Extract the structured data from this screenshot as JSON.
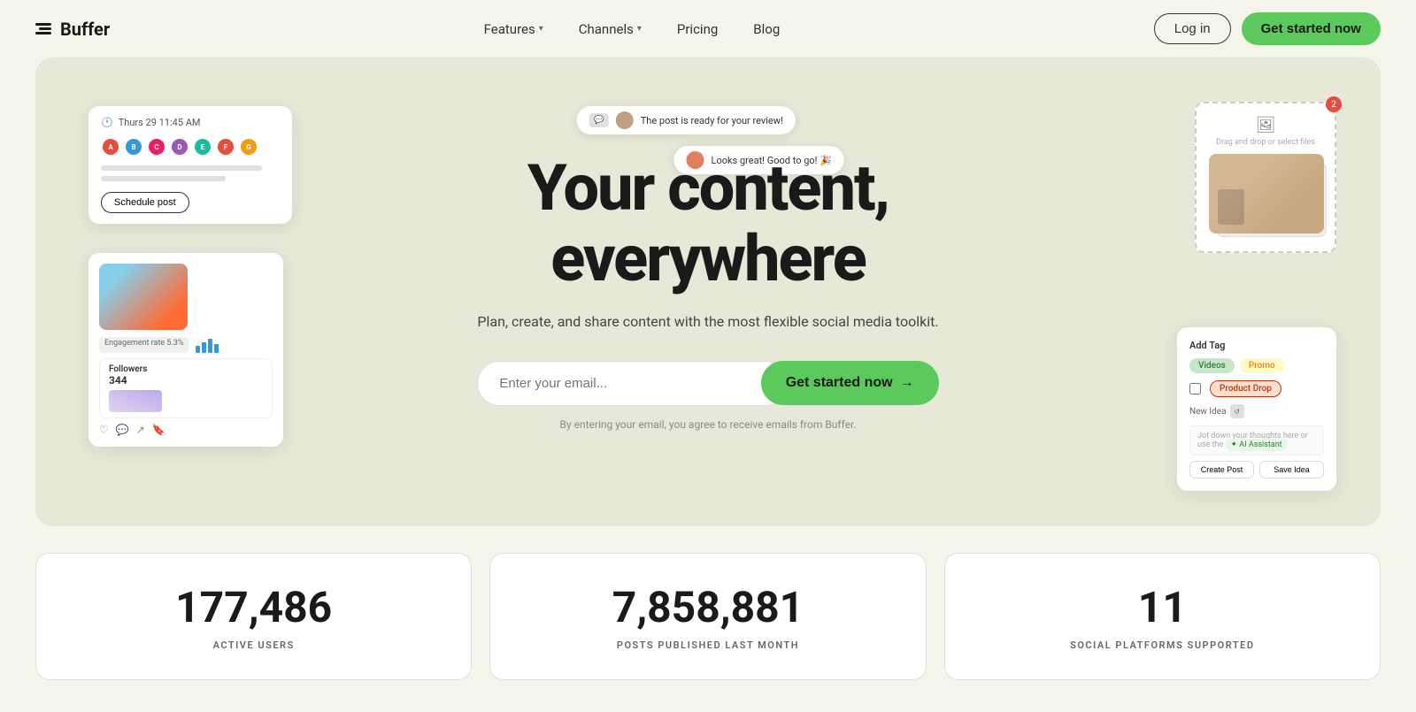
{
  "navbar": {
    "logo_text": "Buffer",
    "nav_items": [
      {
        "label": "Features",
        "has_dropdown": true
      },
      {
        "label": "Channels",
        "has_dropdown": true
      },
      {
        "label": "Pricing",
        "has_dropdown": false
      },
      {
        "label": "Blog",
        "has_dropdown": false
      }
    ],
    "login_label": "Log in",
    "get_started_label": "Get started now"
  },
  "hero": {
    "title_line1": "Your content,",
    "title_line2": "everywhere",
    "subtitle": "Plan, create, and share content with the most flexible social media toolkit.",
    "email_placeholder": "Enter your email...",
    "cta_label": "Get started now",
    "disclaimer": "By entering your email, you agree to receive emails from Buffer.",
    "review1": "The post is ready for your review!",
    "review2": "Looks great! Good to go! 🎉",
    "schedule_time": "Thurs 29  11:45 AM",
    "schedule_btn": "Schedule post",
    "drag_text": "Drag and drop or select files",
    "drag_badge": "2"
  },
  "floating": {
    "add_tag_title": "Add Tag",
    "tag1": "Videos",
    "tag2": "Promo",
    "tag3": "Product Drop",
    "new_idea_label": "New Idea",
    "jot_placeholder": "Jot down your thoughts here or use the",
    "ai_label": "✦ AI Assistant",
    "create_post_btn": "Create Post",
    "save_idea_btn": "Save Idea"
  },
  "stats": [
    {
      "number": "177,486",
      "label": "ACTIVE USERS"
    },
    {
      "number": "7,858,881",
      "label": "POSTS PUBLISHED LAST MONTH"
    },
    {
      "number": "11",
      "label": "SOCIAL PLATFORMS SUPPORTED"
    }
  ]
}
